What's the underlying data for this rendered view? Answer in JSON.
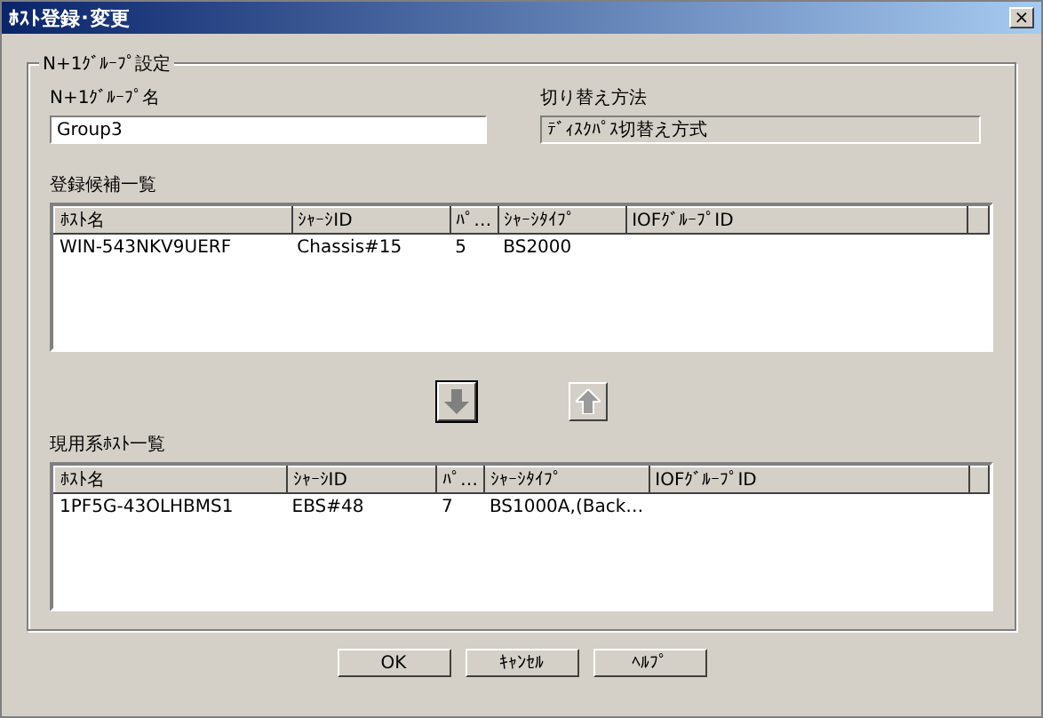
{
  "window": {
    "title": "ﾎｽﾄ登録･変更",
    "close": "×"
  },
  "group": {
    "title": "N+1ｸﾞﾙｰﾌﾟ設定",
    "name_field": {
      "label": "N+1ｸﾞﾙｰﾌﾟ名",
      "value": "Group3"
    },
    "method_field": {
      "label": "切り替え方法",
      "value": "ﾃﾞｨｽｸﾊﾟｽ切替え方式"
    },
    "candidates": {
      "title": "登録候補一覧",
      "columns": [
        "ﾎｽﾄ名",
        "ｼｬｰｼID",
        "ﾊﾟ…",
        "ｼｬｰｼﾀｲﾌﾟ",
        "IOFｸﾞﾙｰﾌﾟID"
      ],
      "rows": [
        [
          "WIN-543NKV9UERF",
          "Chassis#15",
          "5",
          "BS2000",
          ""
        ]
      ]
    },
    "move_buttons": [
      {
        "kind": "down",
        "disabled": false
      },
      {
        "kind": "up",
        "disabled": true
      }
    ],
    "active_hosts": {
      "title": "現用系ﾎｽﾄ一覧",
      "columns": [
        "ﾎｽﾄ名",
        "ｼｬｰｼID",
        "ﾊﾟ…",
        "ｼｬｰｼﾀｲﾌﾟ",
        "IOFｸﾞﾙｰﾌﾟID"
      ],
      "rows": [
        [
          "1PF5G-43OLHBMS1",
          "EBS#48",
          "7",
          "BS1000A,(Back…",
          ""
        ]
      ]
    }
  },
  "buttons": [
    "OK",
    "ｷｬﾝｾﾙ",
    "ﾍﾙﾌﾟ"
  ]
}
